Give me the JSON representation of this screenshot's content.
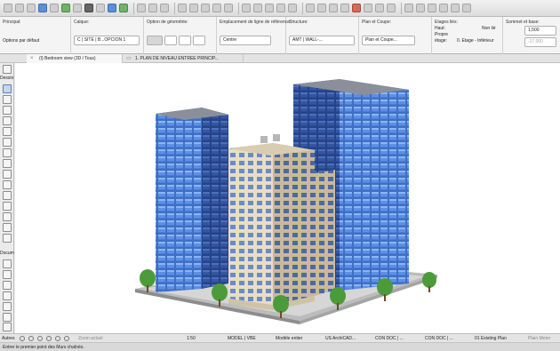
{
  "infobox": {
    "principal": {
      "title": "Principal:",
      "value": "Options par défaut"
    },
    "calque": {
      "title": "Calque:",
      "value": "C | SITE | B...OPCION 1"
    },
    "geometrie": {
      "title": "Option de géométrie:"
    },
    "emplacement": {
      "title": "Emplacement de ligne de référence:",
      "value": "Centre"
    },
    "structure": {
      "title": "Structure:",
      "value": "AMT | WALL-..."
    },
    "plancoupe": {
      "title": "Plan et Coupe:",
      "value": "Plan et Coupe..."
    },
    "etages": {
      "title": "Etages liés:",
      "haut": "Haut:",
      "haut_value": "Non lié",
      "propre": "Propre",
      "etage": "étage:",
      "etage_value": "0. Etage - Inférieur"
    },
    "sommet": {
      "title": "Sommet et base:",
      "top_value": "1,500",
      "bottom_value": "-37,000"
    }
  },
  "tabs": [
    {
      "label": "(I) Bedroom view (3D / Tous)"
    },
    {
      "label": "1. PLAN DE NIVEAU ENTREE PRINCIP..."
    }
  ],
  "leftpanel": {
    "dessin": "Dessin",
    "document": "Document",
    "autres": "Autres"
  },
  "statusbar": {
    "zoom": "Zoom actuel",
    "scale": "1:50",
    "model": "MODEL | VBE",
    "modele": "Modèle entier",
    "us": "US ArchiCAD...",
    "con1": "CON DOC | ...",
    "con2": "CON DOC | ...",
    "existing": "01 Existing Plan",
    "plan_meter": "Plain Meter"
  },
  "hint": "Entrer le premier point des Murs chaînés."
}
